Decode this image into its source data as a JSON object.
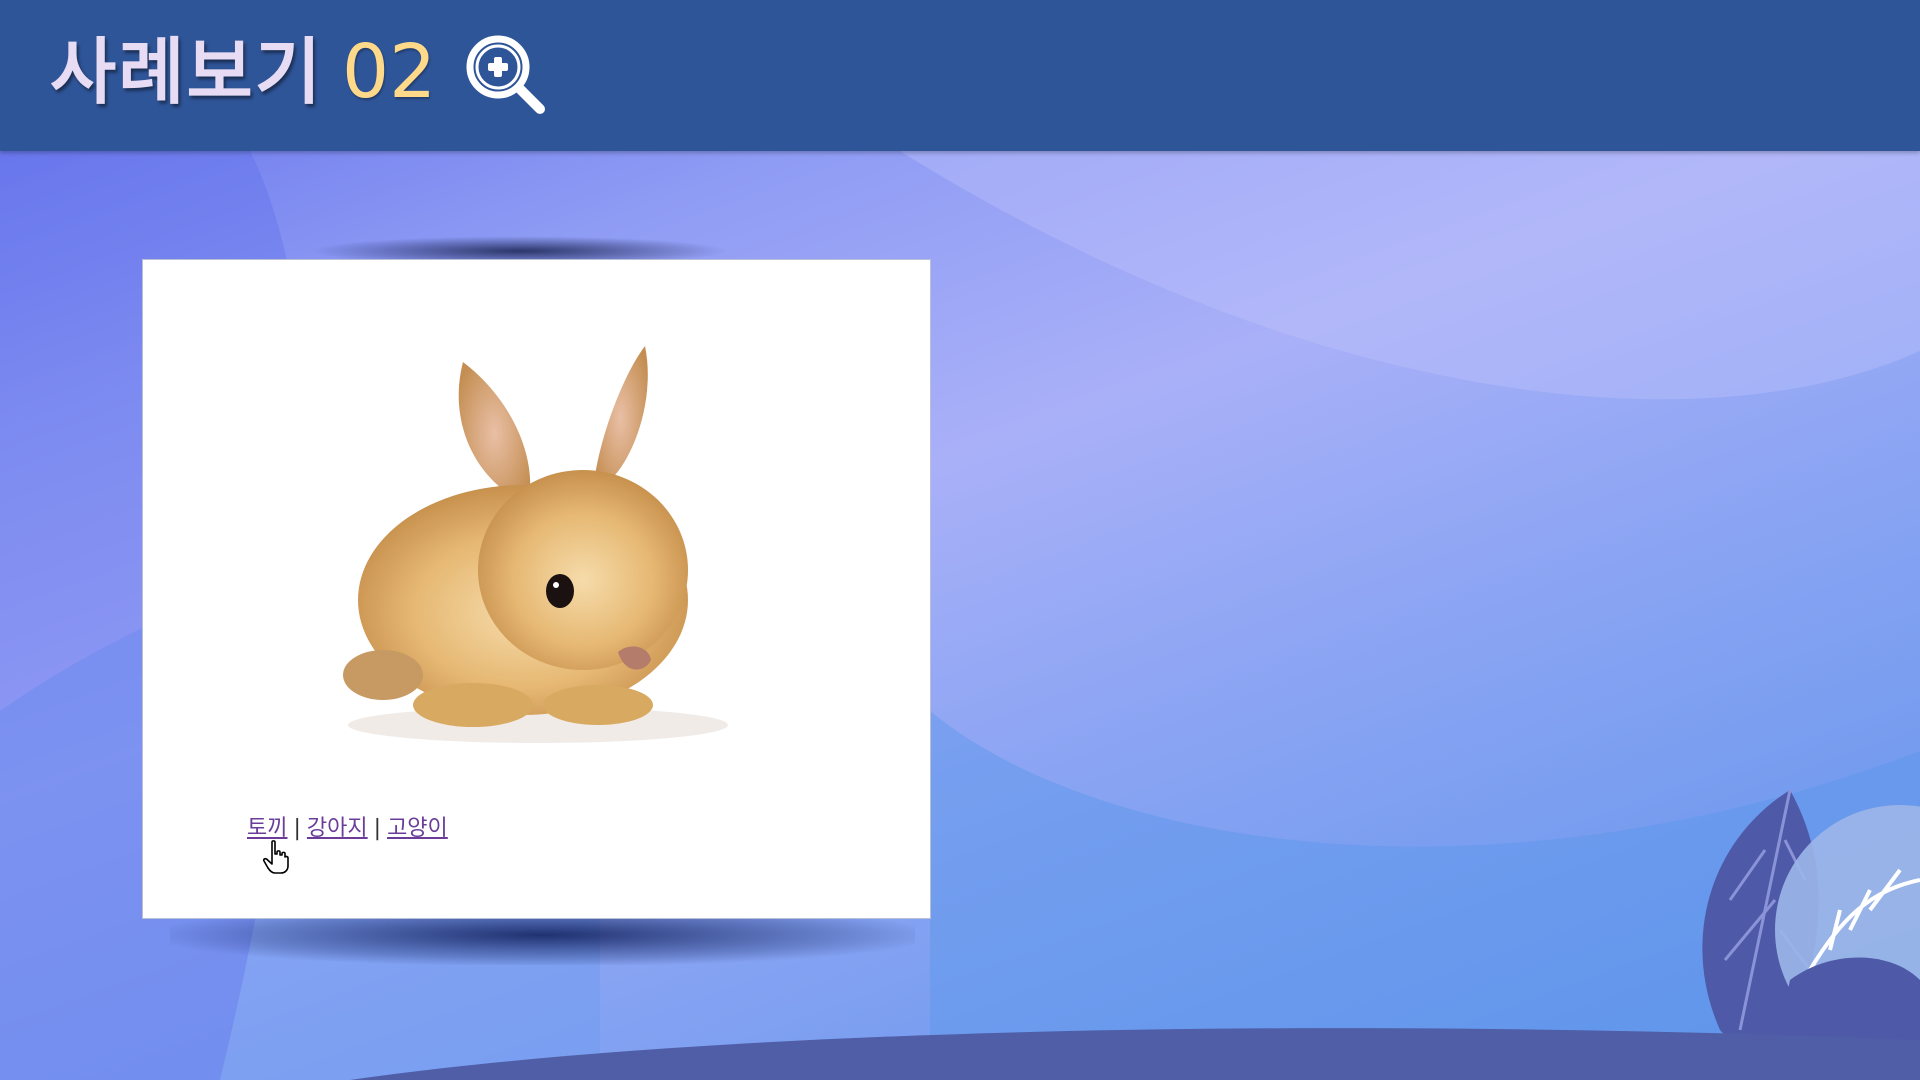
{
  "header": {
    "title": "사례보기",
    "number": "02",
    "zoom_icon": "zoom-in-icon"
  },
  "card": {
    "image_alt_icon": "rabbit-image",
    "links": [
      {
        "label": "토끼"
      },
      {
        "label": "강아지"
      },
      {
        "label": "고양이"
      }
    ],
    "separator": "|"
  },
  "colors": {
    "header_bg": "#2f5599",
    "title_number": "#ffd98a",
    "link": "#6a3d9a"
  }
}
